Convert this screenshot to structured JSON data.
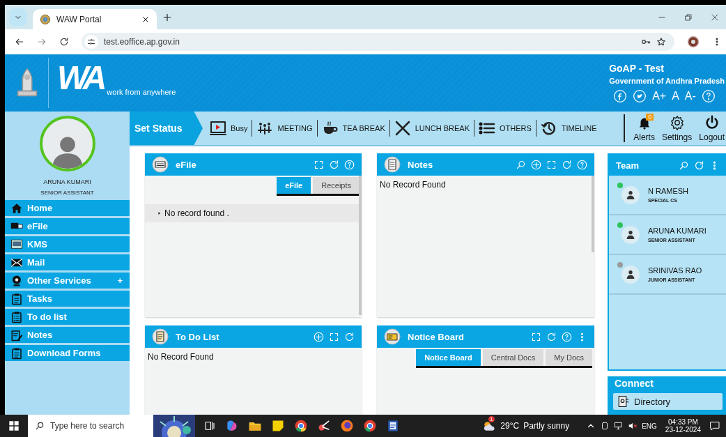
{
  "browser": {
    "tab_title": "WAW Portal",
    "url": "test.eoffice.ap.gov.in"
  },
  "header": {
    "logo_text": "WA",
    "tagline": "work from anywhere",
    "org_title": "GoAP - Test",
    "org_subtitle": "Government of Andhra Pradesh",
    "font_controls": [
      "A+",
      "A",
      "A-"
    ]
  },
  "status_bar": {
    "label": "Set Status",
    "items": [
      {
        "label": "Busy",
        "kind": "busy"
      },
      {
        "label": "MEETING",
        "kind": "meeting"
      },
      {
        "label": "TEA BREAK",
        "kind": "tea"
      },
      {
        "label": "LUNCH BREAK",
        "kind": "lunch"
      },
      {
        "label": "OTHERS",
        "kind": "others"
      },
      {
        "label": "TIMELINE",
        "kind": "timeline"
      }
    ],
    "actions": [
      {
        "label": "Alerts",
        "kind": "alerts",
        "badge": "0"
      },
      {
        "label": "Settings",
        "kind": "settings"
      },
      {
        "label": "Logout",
        "kind": "logout"
      }
    ]
  },
  "profile": {
    "name": "ARUNA KUMARI",
    "designation": "SENIOR ASSISTANT"
  },
  "sidebar": {
    "items": [
      {
        "label": "Home",
        "kind": "home"
      },
      {
        "label": "eFile",
        "kind": "efile"
      },
      {
        "label": "KMS",
        "kind": "kms"
      },
      {
        "label": "Mail",
        "kind": "mail"
      },
      {
        "label": "Other Services",
        "kind": "services",
        "expand_sign": "+"
      },
      {
        "label": "Tasks",
        "kind": "clipboard"
      },
      {
        "label": "To do list",
        "kind": "checklist"
      },
      {
        "label": "Notes",
        "kind": "notes"
      },
      {
        "label": "Download Forms",
        "kind": "clipboard"
      }
    ]
  },
  "panels": [
    {
      "title": "eFile",
      "kind": "efile",
      "tools": [
        {
          "kind": "expand"
        },
        {
          "kind": "refresh"
        },
        {
          "kind": "help"
        }
      ],
      "tabs": [
        {
          "label": "eFile",
          "selected": true
        },
        {
          "label": "Receipts",
          "selected": false
        }
      ],
      "row": "No record found ."
    },
    {
      "title": "Notes",
      "kind": "notes",
      "tools": [
        {
          "kind": "search"
        },
        {
          "kind": "add"
        },
        {
          "kind": "expand"
        },
        {
          "kind": "refresh"
        },
        {
          "kind": "help"
        }
      ],
      "message": "No Record Found"
    },
    {
      "title": "To Do List",
      "kind": "todo",
      "tools": [
        {
          "kind": "add"
        },
        {
          "kind": "expand"
        },
        {
          "kind": "refresh"
        }
      ],
      "message": "No Record Found"
    },
    {
      "title": "Notice Board",
      "kind": "notice",
      "tools": [
        {
          "kind": "expand"
        },
        {
          "kind": "refresh"
        },
        {
          "kind": "help"
        },
        {
          "kind": "more"
        }
      ],
      "tabs": [
        {
          "label": "Notice Board",
          "selected": true
        },
        {
          "label": "Central Docs",
          "selected": false
        },
        {
          "label": "My Docs",
          "selected": false
        }
      ]
    }
  ],
  "team": {
    "title": "Team",
    "members": [
      {
        "name": "N RAMESH",
        "role": "SPECIAL CS",
        "online": true
      },
      {
        "name": "ARUNA KUMARI",
        "role": "SENIOR ASSISTANT",
        "online": true
      },
      {
        "name": "SRINIVAS RAO",
        "role": "JUNIOR ASSISTANT",
        "online": false
      }
    ]
  },
  "connect": {
    "title": "Connect",
    "items": [
      "Directory"
    ]
  },
  "taskbar": {
    "search_placeholder": "Type here to search",
    "weather_badge": "1",
    "temperature": "29°C",
    "weather": "Partly sunny",
    "language": "ENG",
    "time": "04:33 PM",
    "date": "23-12-2024"
  }
}
